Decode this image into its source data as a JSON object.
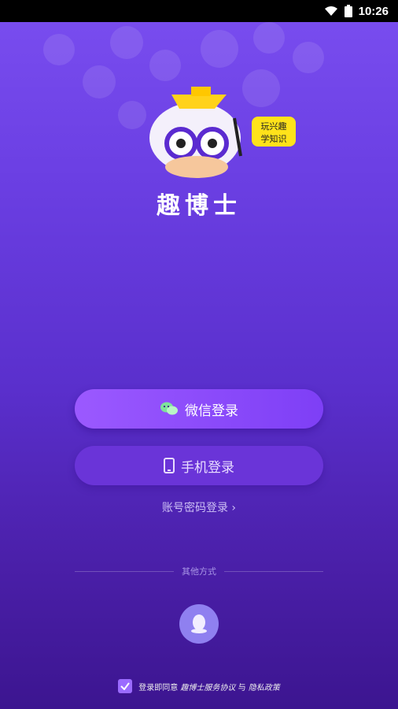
{
  "status_bar": {
    "time": "10:26"
  },
  "app": {
    "title": "趣博士",
    "speech_bubble": "玩兴趣\n学知识"
  },
  "buttons": {
    "wechat_label": "微信登录",
    "phone_label": "手机登录",
    "account_label": "账号密码登录 ›"
  },
  "other_methods": {
    "label": "其他方式"
  },
  "agreement": {
    "prefix": "登录即同意",
    "service_link": "趣博士服务协议",
    "joiner": "与",
    "privacy_link": "隐私政策",
    "checked": true
  },
  "colors": {
    "accent": "#7e3ff6",
    "background_top": "#7a4ef0",
    "background_bottom": "#3c1590"
  }
}
